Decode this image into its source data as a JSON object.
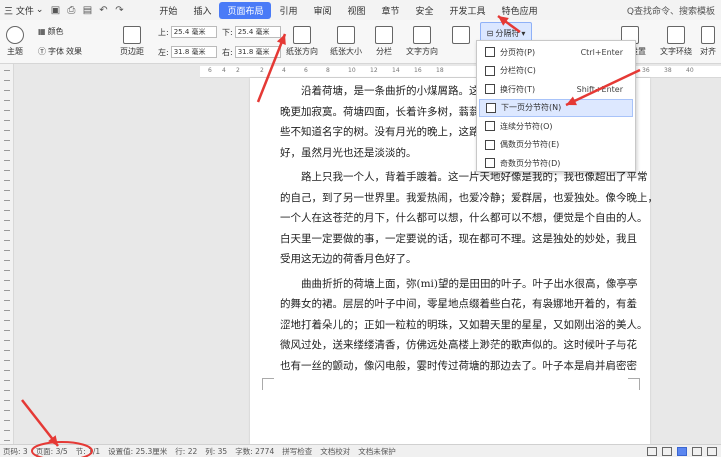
{
  "menubar": {
    "file_label": "三 文件",
    "tabs": [
      "开始",
      "插入",
      "页面布局",
      "引用",
      "审阅",
      "视图",
      "章节",
      "安全",
      "开发工具",
      "特色应用"
    ],
    "active_tab": 2,
    "search_label": "Q查找命令、搜索模板"
  },
  "ribbon": {
    "theme": "主题",
    "color": "颜色",
    "font": "字体",
    "effect": "效果",
    "margin": "页边距",
    "top_label": "上:",
    "top_value": "25.4 毫米",
    "bottom_label": "下:",
    "bottom_value": "25.4 毫米",
    "left_label": "左:",
    "left_value": "31.8 毫米",
    "right_label": "右:",
    "right_value": "31.8 毫米",
    "orientation": "纸张方向",
    "size": "纸张大小",
    "columns": "分栏",
    "text_direction": "文字方向",
    "break_button": "分隔符",
    "page_setup": "稿纸设置",
    "text_wrap": "文字环绕",
    "align": "对齐"
  },
  "dropdown": {
    "items": [
      {
        "label": "分页符(P)",
        "shortcut": "Ctrl+Enter"
      },
      {
        "label": "分栏符(C)",
        "shortcut": ""
      },
      {
        "label": "换行符(T)",
        "shortcut": "Shift+Enter"
      },
      {
        "label": "下一页分节符(N)",
        "shortcut": ""
      },
      {
        "label": "连续分节符(O)",
        "shortcut": ""
      },
      {
        "label": "偶数页分节符(E)",
        "shortcut": ""
      },
      {
        "label": "奇数页分节符(D)",
        "shortcut": ""
      }
    ],
    "hovered": 3
  },
  "ruler_numbers": [
    "6",
    "4",
    "2",
    "2",
    "4",
    "6",
    "8",
    "10",
    "12",
    "14",
    "16",
    "18",
    "32",
    "34",
    "36",
    "38",
    "40"
  ],
  "document": {
    "lines": [
      "沿着荷塘，是一条曲折的小煤屑路。这路幽僻；白天也少人走，夜",
      "晚更加寂寞。荷塘四面，长着许多树，蓊蓊郁郁的。路的一旁，是",
      "些不知道名字的树。没有月光的晚上，这路上阴森森的；今晚却很",
      "好，虽然月光也还是淡淡的。",
      "路上只我一个人，背着手踱着。这一片天地好像是我的；我也像超出了平常",
      "的自己，到了另一世界里。我爱热闹，也爱冷静；爱群居，也爱独处。像今晚上，",
      "一个人在这苍茫的月下，什么都可以想，什么都可以不想，便觉是个自由的人。",
      "白天里一定要做的事，一定要说的话，现在都可不理。这是独处的妙处，我且",
      "受用这无边的荷香月色好了。",
      "曲曲折折的荷塘上面，弥(mi)望的是田田的叶子。叶子出水很高，像亭亭",
      "的舞女的裙。层层的叶子中间，零星地点缀着些白花，有袅娜地开着的，有羞",
      "涩地打着朵儿的；正如一粒粒的明珠，又如碧天里的星星，又如刚出浴的美人。",
      "微风过处，送来缕缕清香，仿佛远处高楼上渺茫的歌声似的。这时候叶子与花",
      "也有一丝的颤动，像闪电般，霎时传过荷塘的那边去了。叶子本是肩并肩密密"
    ]
  },
  "statusbar": {
    "page_num": "页码: 3",
    "page_total": "页面: 3/5",
    "section": "节: 1/1",
    "settings": "设置值: 25.3厘米",
    "row": "行: 22",
    "col": "列: 35",
    "words": "字数: 2774",
    "spell": "拼写检查",
    "proof": "文档校对",
    "protect": "文档未保护"
  },
  "colors": {
    "accent": "#4a7bf7",
    "annotation": "#e53935",
    "hover_bg": "#dde8ff"
  }
}
